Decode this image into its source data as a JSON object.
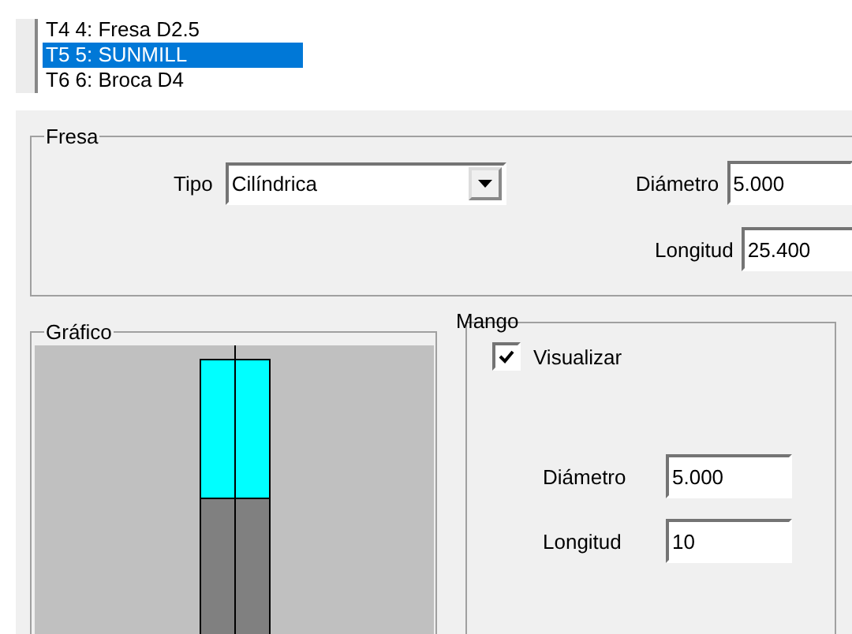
{
  "tool_list": {
    "items": [
      {
        "label": "T4 4: Fresa D2.5",
        "selected": false
      },
      {
        "label": "T5 5: SUNMILL",
        "selected": true
      },
      {
        "label": "T6 6: Broca D4",
        "selected": false
      }
    ]
  },
  "fresa": {
    "title": "Fresa",
    "tipo": {
      "label": "Tipo",
      "value": "Cilíndrica"
    },
    "diametro": {
      "label": "Diámetro",
      "value": "5.000"
    },
    "longitud": {
      "label": "Longitud",
      "value": "25.400"
    }
  },
  "grafico": {
    "title": "Gráfico"
  },
  "mango": {
    "title": "Mango",
    "visualizar": {
      "label": "Visualizar",
      "checked": true
    },
    "diametro": {
      "label": "Diámetro",
      "value": "5.000"
    },
    "longitud": {
      "label": "Longitud",
      "value": "10"
    }
  }
}
